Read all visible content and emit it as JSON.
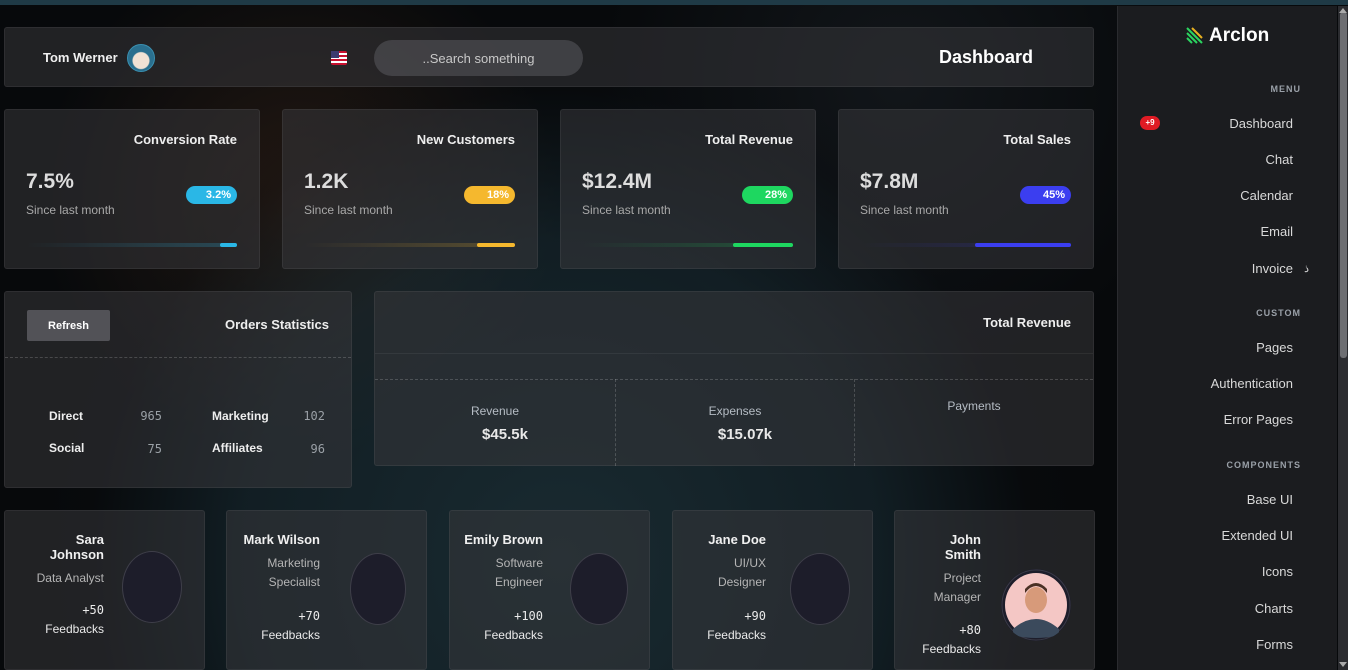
{
  "header": {
    "user_name": "Tom Werner",
    "search_placeholder": "..Search something",
    "title": "Dashboard"
  },
  "stats": [
    {
      "title": "Conversion Rate",
      "value": "7.5%",
      "since": "Since last month",
      "badge": "3.2%",
      "color": "#2ab7e6",
      "progress": 0.08
    },
    {
      "title": "New Customers",
      "value": "1.2K",
      "since": "Since last month",
      "badge": "18%",
      "color": "#f5b82e",
      "progress": 0.18
    },
    {
      "title": "Total Revenue",
      "value": "$12.4M",
      "since": "Since last month",
      "badge": "28%",
      "color": "#1ed760",
      "progress": 0.28
    },
    {
      "title": "Total Sales",
      "value": "$7.8M",
      "since": "Since last month",
      "badge": "45%",
      "color": "#3b3ef0",
      "progress": 0.45
    }
  ],
  "orders": {
    "refresh_label": "Refresh",
    "title": "Orders Statistics",
    "items": [
      {
        "label": "Direct",
        "value": "965"
      },
      {
        "label": "Marketing",
        "value": "102"
      },
      {
        "label": "Social",
        "value": "75"
      },
      {
        "label": "Affiliates",
        "value": "96"
      }
    ]
  },
  "revenue": {
    "title": "Total Revenue",
    "columns": [
      {
        "label": "Revenue",
        "value": "$45.5k"
      },
      {
        "label": "Expenses",
        "value": "$15.07k"
      },
      {
        "label": "Payments",
        "value": ""
      }
    ]
  },
  "team": [
    {
      "name_lines": [
        "Sara",
        "Johnson"
      ],
      "role_lines": [
        "Data Analyst"
      ],
      "count": "+50",
      "feedback": "Feedbacks"
    },
    {
      "name_lines": [
        "Mark Wilson"
      ],
      "role_lines": [
        "Marketing",
        "Specialist"
      ],
      "count": "+70",
      "feedback": "Feedbacks"
    },
    {
      "name_lines": [
        "Emily Brown"
      ],
      "role_lines": [
        "Software",
        "Engineer"
      ],
      "count": "+100",
      "feedback": "Feedbacks"
    },
    {
      "name_lines": [
        "Jane Doe"
      ],
      "role_lines": [
        "UI/UX",
        "Designer"
      ],
      "count": "+90",
      "feedback": "Feedbacks"
    },
    {
      "name_lines": [
        "John",
        "Smith"
      ],
      "role_lines": [
        "Project",
        "Manager"
      ],
      "count": "+80",
      "feedback": "Feedbacks"
    }
  ],
  "sidebar": {
    "logo": "Arclon",
    "menu_heading": "MENU",
    "menu_badge": "+9",
    "menu": [
      "Dashboard",
      "Chat",
      "Calendar",
      "Email",
      "Invoice"
    ],
    "custom_heading": "CUSTOM",
    "custom": [
      "Pages",
      "Authentication",
      "Error Pages"
    ],
    "components_heading": "COMPONENTS",
    "components": [
      "Base UI",
      "Extended UI",
      "Icons",
      "Charts",
      "Forms"
    ]
  }
}
